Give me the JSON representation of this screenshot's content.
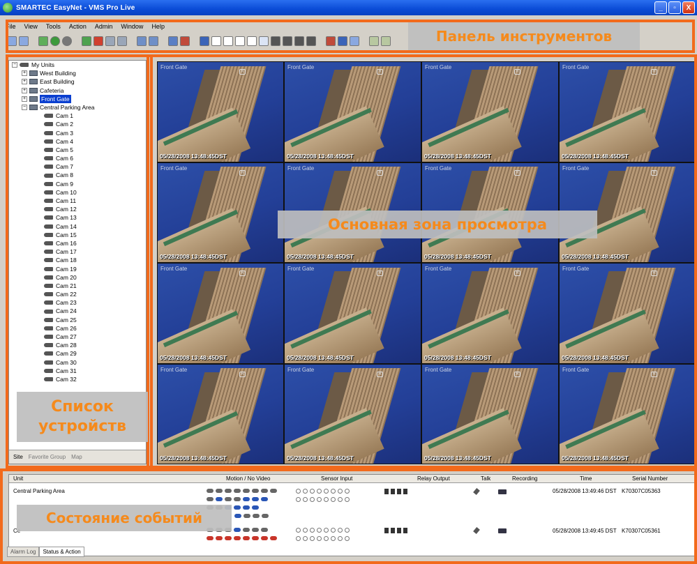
{
  "window": {
    "title": "SMARTEC EasyNet - VMS Pro Live",
    "controls": [
      "_",
      "▫",
      "X"
    ]
  },
  "menu": [
    "File",
    "View",
    "Tools",
    "Action",
    "Admin",
    "Window",
    "Help"
  ],
  "callouts": {
    "toolbar": "Панель инструментов",
    "viewer": "Основная зона просмотра",
    "device_list_line1": "Список",
    "device_list_line2": "устройств",
    "events": "Состояние событий"
  },
  "tree": {
    "root": "My Units",
    "sites": [
      "West Building",
      "East Building",
      "Cafeteria",
      "Front Gate",
      "Central Parking Area"
    ],
    "selected": "Front Gate",
    "cameras": [
      "Cam 1",
      "Cam 2",
      "Cam 3",
      "Cam 4",
      "Cam 5",
      "Cam 6",
      "Cam 7",
      "Cam 8",
      "Cam 9",
      "Cam 10",
      "Cam 11",
      "Cam 12",
      "Cam 13",
      "Cam 14",
      "Cam 15",
      "Cam 16",
      "Cam 17",
      "Cam 18",
      "Cam 19",
      "Cam 20",
      "Cam 21",
      "Cam 22",
      "Cam 23",
      "Cam 24",
      "Cam 25",
      "Cam 26",
      "Cam 27",
      "Cam 28",
      "Cam 29",
      "Cam 30",
      "Cam 31",
      "Cam 32"
    ]
  },
  "left_tabs": [
    "Site",
    "Favorite Group",
    "Map"
  ],
  "video": {
    "timestamp": "05/28/2008 13:48:45DST",
    "tile_labels": [
      "Front Gate",
      "Front Gate",
      "Front Gate",
      "Front Gate",
      "Front Gate",
      "Front Gate",
      "Front Gate",
      "Front Gate",
      "Front Gate",
      "Front Gate",
      "Front Gate",
      "Front Gate",
      "Front Gate",
      "Front Gate",
      "Front Gate",
      "Front Gate"
    ]
  },
  "events": {
    "headers": [
      "Unit",
      "Motion / No Video",
      "Sensor Input",
      "Relay Output",
      "Talk",
      "Recording",
      "Time",
      "Serial Number"
    ],
    "rows": [
      {
        "unit": "Central Parking Area",
        "time": "05/28/2008 13:49:46 DST",
        "serial": "K70307C05363"
      },
      {
        "unit": "Ce",
        "time": "05/28/2008 13:49:45 DST",
        "serial": "K70307C05361"
      }
    ],
    "tabs": [
      "Alarm Log",
      "Status & Action"
    ]
  },
  "colors": {
    "accent_orange": "#f26a1b",
    "callout_text": "#f58a1c",
    "titlebar_blue": "#0a4bd6"
  }
}
